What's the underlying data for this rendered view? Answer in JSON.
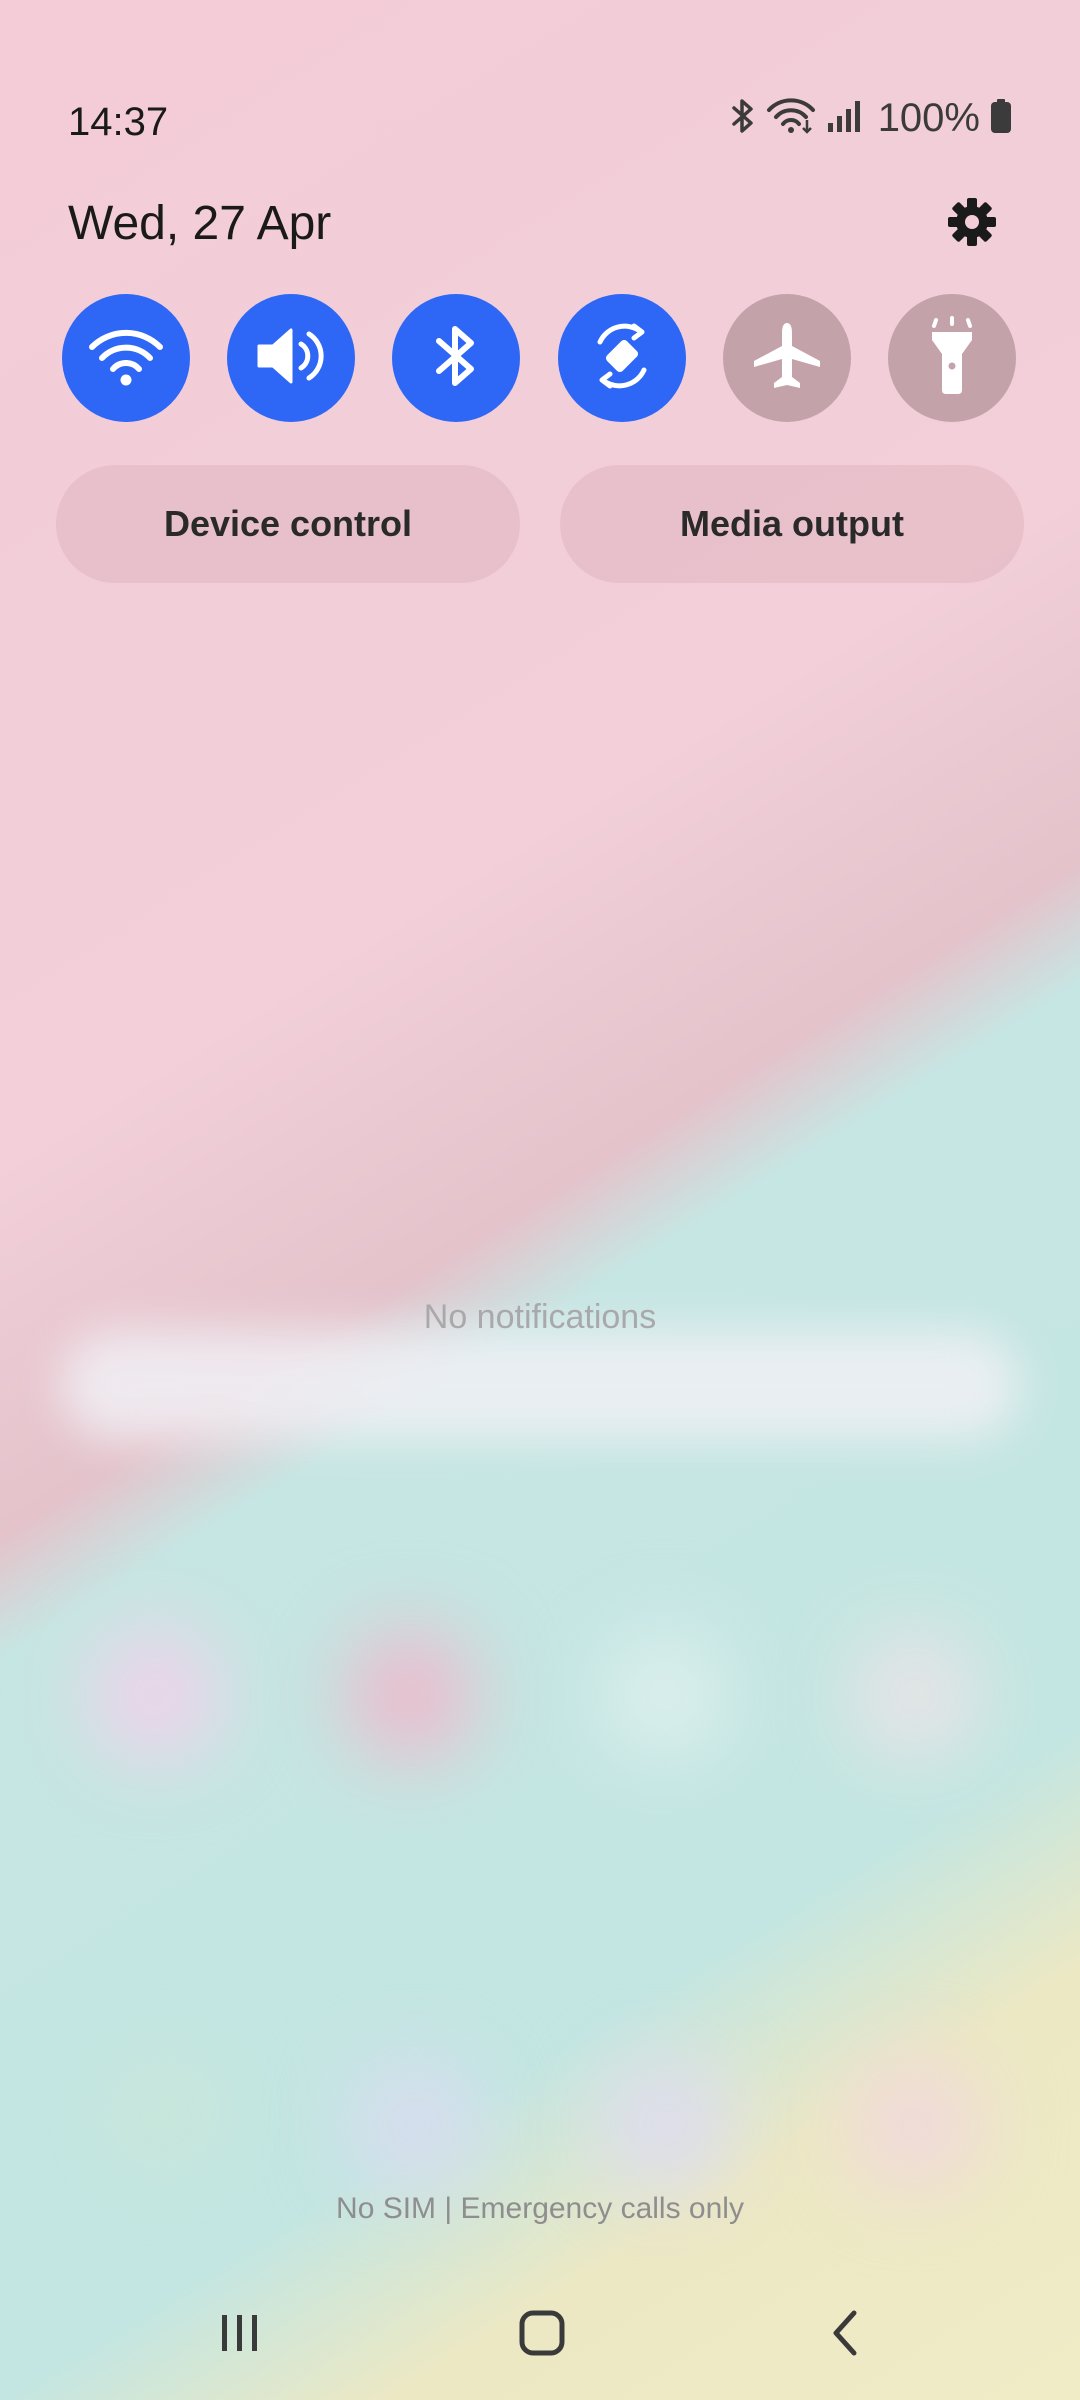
{
  "status_bar": {
    "time": "14:37",
    "battery": "100%",
    "icons": [
      "bluetooth-icon",
      "wifi-icon",
      "signal-icon",
      "battery-icon"
    ]
  },
  "header": {
    "date": "Wed, 27 Apr",
    "settings_icon": "gear-icon"
  },
  "quick_toggles": [
    {
      "name": "Wi-Fi",
      "icon": "wifi-icon",
      "state": "on"
    },
    {
      "name": "Sound",
      "icon": "sound-icon",
      "state": "on"
    },
    {
      "name": "Bluetooth",
      "icon": "bluetooth-icon",
      "state": "on"
    },
    {
      "name": "Auto rotate",
      "icon": "rotate-icon",
      "state": "on"
    },
    {
      "name": "Airplane mode",
      "icon": "airplane-icon",
      "state": "off"
    },
    {
      "name": "Flashlight",
      "icon": "flashlight-icon",
      "state": "off"
    }
  ],
  "buttons": {
    "device_control": "Device control",
    "media_output": "Media output"
  },
  "notifications": {
    "empty_text": "No notifications"
  },
  "footer": {
    "carrier": "No SIM | Emergency calls only"
  },
  "nav_bar": {
    "recents_icon": "recents-icon",
    "home_icon": "home-icon",
    "back_icon": "back-icon"
  },
  "colors": {
    "toggle_on": "#2e67f5",
    "toggle_off": "#c4a2aa"
  }
}
